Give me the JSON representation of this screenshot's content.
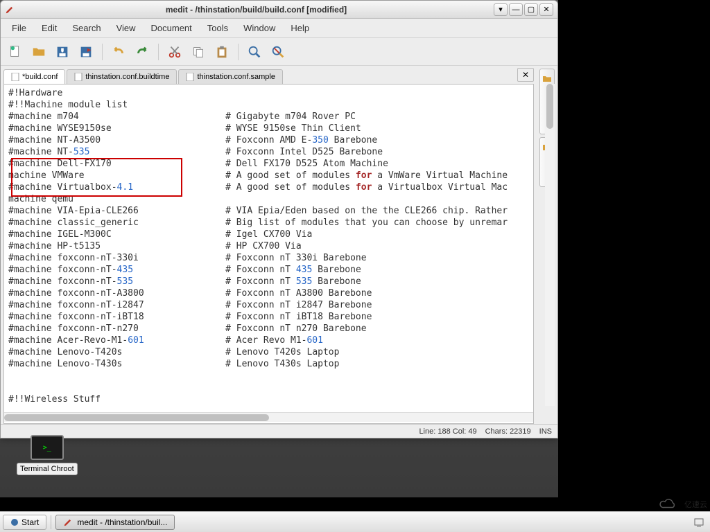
{
  "window": {
    "title": "medit - /thinstation/build/build.conf [modified]"
  },
  "menu": {
    "file": "File",
    "edit": "Edit",
    "search": "Search",
    "view": "View",
    "document": "Document",
    "tools": "Tools",
    "window": "Window",
    "help": "Help"
  },
  "tabs": {
    "t0": "*build.conf",
    "t1": "thinstation.conf.buildtime",
    "t2": "thinstation.conf.sample"
  },
  "side": {
    "selector": "File Selector",
    "list": "File List"
  },
  "status": {
    "pos": "Line: 188 Col: 49",
    "chars": "Chars: 22319",
    "mode": "INS"
  },
  "code": {
    "l0": "#!Hardware",
    "l1": "#!!Machine module list",
    "l2a": "#machine m704",
    "l2b": "# Gigabyte m704 Rover PC",
    "l3a": "#machine WYSE9150se",
    "l3b": "# WYSE 9150se Thin Client",
    "l4a": "#machine NT-A3500",
    "l4b1": "# Foxconn AMD E-",
    "l4n": "350",
    "l4b2": " Barebone",
    "l5a": "#machine NT-",
    "l5n": "535",
    "l5b": "# Foxconn Intel D525 Barebone",
    "l6a": "#machine Dell-FX170",
    "l6b": "# Dell FX170 D525 Atom Machine",
    "l7a": "machine VMWare",
    "l7b1": "# A good set of modules ",
    "l7k": "for",
    "l7b2": " a VmWare Virtual Machine",
    "l8a": "#machine Virtualbox-",
    "l8n": "4.1",
    "l8b1": "# A good set of modules ",
    "l8k": "for",
    "l8b2": " a Virtualbox Virtual Mac",
    "l9a": "machine qemu",
    "l10a": "#machine VIA-Epia-CLE266",
    "l10b": "# VIA Epia/Eden based on the the CLE266 chip. Rather",
    "l11a": "#machine classic_generic",
    "l11b": "# Big list of modules that you can choose by unremar",
    "l12a": "#machine IGEL-M300C",
    "l12b": "# Igel CX700 Via",
    "l13a": "#machine HP-t5135",
    "l13b": "# HP CX700 Via",
    "l14a": "#machine foxconn-nT-330i",
    "l14b": "# Foxconn nT 330i Barebone",
    "l15a": "#machine foxconn-nT-",
    "l15n": "435",
    "l15b1": "# Foxconn nT ",
    "l15n2": "435",
    "l15b2": " Barebone",
    "l16a": "#machine foxconn-nT-",
    "l16n": "535",
    "l16b1": "# Foxconn nT ",
    "l16n2": "535",
    "l16b2": " Barebone",
    "l17a": "#machine foxconn-nT-A3800",
    "l17b": "# Foxconn nT A3800 Barebone",
    "l18a": "#machine foxconn-nT-i2847",
    "l18b": "# Foxconn nT i2847 Barebone",
    "l19a": "#machine foxconn-nT-iBT18",
    "l19b": "# Foxconn nT iBT18 Barebone",
    "l20a": "#machine foxconn-nT-n270",
    "l20b": "# Foxconn nT n270 Barebone",
    "l21a": "#machine Acer-Revo-M1-",
    "l21n": "601",
    "l21b1": "# Acer Revo M1-",
    "l21n2": "601",
    "l22a": "#machine Lenovo-T420s",
    "l22b": "# Lenovo T420s Laptop",
    "l23a": "#machine Lenovo-T430s",
    "l23b": "# Lenovo T430s Laptop",
    "l24": "",
    "l25": "",
    "l26": "#!!Wireless Stuff"
  },
  "desktop_icon": {
    "label": "Terminal Chroot",
    "glyph": ">_"
  },
  "taskbar": {
    "start": "Start",
    "task0": "medit - /thinstation/buil..."
  },
  "watermark": "亿速云"
}
